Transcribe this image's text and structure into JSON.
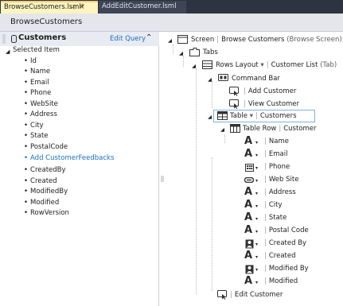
{
  "tabs": [
    {
      "label": "BrowseCustomers.lsml*",
      "active": true
    },
    {
      "label": "AddEditCustomer.lsml",
      "active": false
    }
  ],
  "doc_title": "BrowseCustomers",
  "left_pane": {
    "title": "Customers",
    "edit_query": "Edit Query",
    "selected_item": "Selected Item",
    "fields": [
      "Id",
      "Name",
      "Email",
      "Phone",
      "WebSite",
      "Address",
      "City",
      "State",
      "PostalCode"
    ],
    "add_link": "Add CustomerFeedbacks",
    "fields2": [
      "CreatedBy",
      "Created",
      "ModifiedBy",
      "Modified",
      "RowVersion"
    ]
  },
  "tree": {
    "screen_label": "Screen",
    "screen_name": "Browse Customers",
    "screen_type": "(Browse Screen)",
    "tabs_label": "Tabs",
    "rows_layout": "Rows Layout",
    "rows_name": "Customer List",
    "rows_type": "(Tab)",
    "command_bar": "Command Bar",
    "add_customer": "Add Customer",
    "view_customer": "View Customer",
    "table_label": "Table",
    "table_name": "Customers",
    "table_row": "Table Row",
    "table_row_name": "Customer",
    "columns": [
      "Name",
      "Email",
      "Phone",
      "Web Site",
      "Address",
      "City",
      "State",
      "Postal Code",
      "Created By",
      "Created",
      "Modified By",
      "Modified"
    ],
    "edit_customer": "Edit Customer"
  },
  "colors": {
    "tab_strip": "#2d3340",
    "active_tab": "#fdf4bf",
    "link": "#1c6fc0",
    "header": "#e4e6ec"
  }
}
